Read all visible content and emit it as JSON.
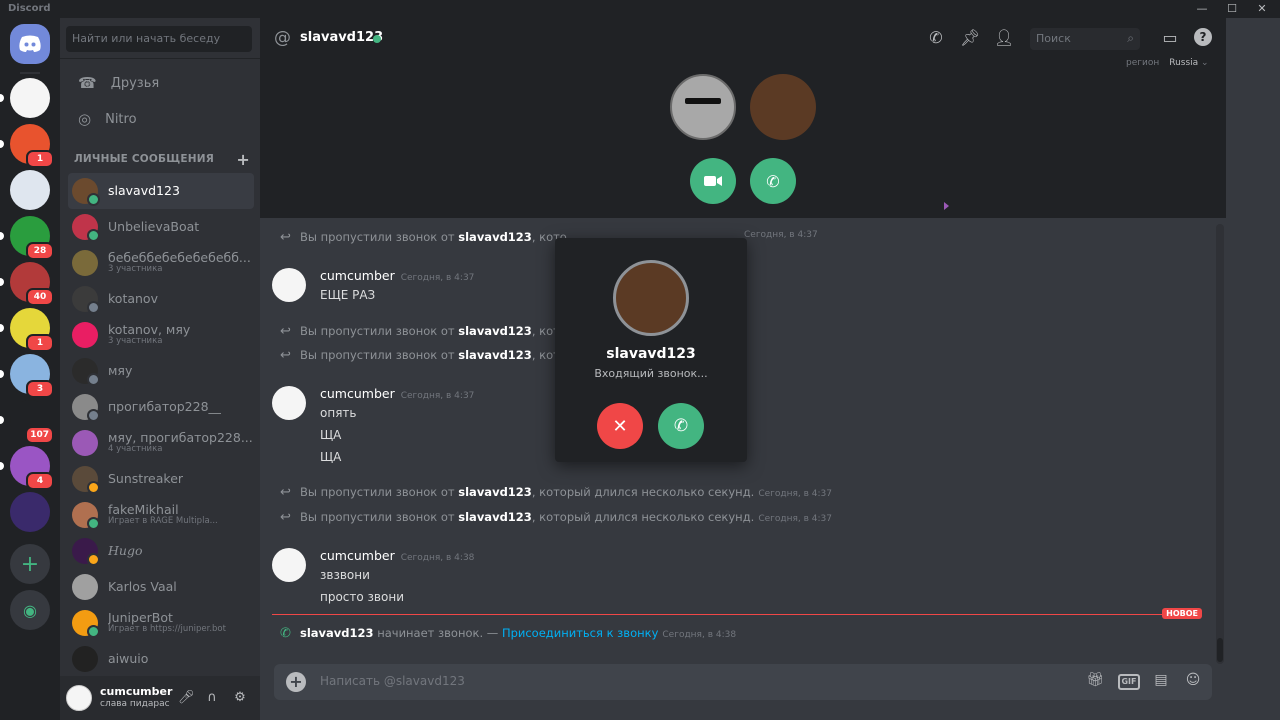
{
  "window": {
    "app_name": "Discord"
  },
  "servers": [
    {
      "name": "server-car",
      "badge": ""
    },
    {
      "name": "server-k",
      "badge": "1"
    },
    {
      "name": "server-anime",
      "badge": ""
    },
    {
      "name": "server-green",
      "badge": "28"
    },
    {
      "name": "server-face",
      "badge": "40"
    },
    {
      "name": "server-yellow",
      "badge": "1"
    },
    {
      "name": "server-blue",
      "badge": "3"
    },
    {
      "name": "server-text",
      "badge": "107"
    },
    {
      "name": "server-purple",
      "badge": "4"
    },
    {
      "name": "server-dark",
      "badge": ""
    }
  ],
  "sidebar": {
    "search_placeholder": "Найти или начать беседу",
    "friends": "Друзья",
    "nitro": "Nitro",
    "dm_header": "ЛИЧНЫЕ СООБЩЕНИЯ",
    "dms": [
      {
        "name": "slavavd123",
        "sub": ""
      },
      {
        "name": "UnbelievaBoat",
        "sub": ""
      },
      {
        "name": "бебеббебебебебебб...",
        "sub": "3 участника"
      },
      {
        "name": "kotanov",
        "sub": ""
      },
      {
        "name": "kotanov, мяу",
        "sub": "3 участника"
      },
      {
        "name": "мяу",
        "sub": ""
      },
      {
        "name": "прогибатор228__",
        "sub": ""
      },
      {
        "name": "мяу, прогибатор228...",
        "sub": "4 участника"
      },
      {
        "name": "Sunstreaker",
        "sub": ""
      },
      {
        "name": "fakeMikhail",
        "sub": "Играет в RAGE Multipla..."
      },
      {
        "name": "Hugo",
        "sub": ""
      },
      {
        "name": "Karlos Vaal",
        "sub": ""
      },
      {
        "name": "JuniperBot",
        "sub": "Играет в https://juniper.bot"
      },
      {
        "name": "aiwuio",
        "sub": ""
      }
    ],
    "user": {
      "name": "cumcumber",
      "status": "слава пидарас"
    }
  },
  "topbar": {
    "channel": "slavavd123",
    "search_placeholder": "Поиск",
    "region_label": "регион",
    "region_value": "Russia"
  },
  "messages": {
    "missed_prefix": "Вы пропустили звонок от",
    "missed_user": "slavavd123",
    "missed_suffix_short": ", кото",
    "missed_suffix_full": ", который длился несколько секунд.",
    "ts_437": "Сегодня, в 4:37",
    "ts_438": "Сегодня, в 4:38",
    "author": "cumcumber",
    "g1_lines": [
      "ЕЩЕ РАЗ"
    ],
    "g2_lines": [
      "опять",
      "ЩА",
      "ЩА"
    ],
    "g3_lines": [
      "звзвони",
      "просто звони"
    ],
    "new_badge": "НОВОЕ",
    "call_user": "slavavd123",
    "call_text": "начинает звонок. —",
    "call_link": "Присоединиться к звонку"
  },
  "composer": {
    "placeholder": "Написать @slavavd123",
    "gif": "GIF"
  },
  "modal": {
    "name": "slavavd123",
    "subtitle": "Входящий звонок..."
  },
  "colors": {
    "accent": "#7289da",
    "green": "#43b581",
    "red": "#f04747",
    "link": "#00b0f4"
  }
}
